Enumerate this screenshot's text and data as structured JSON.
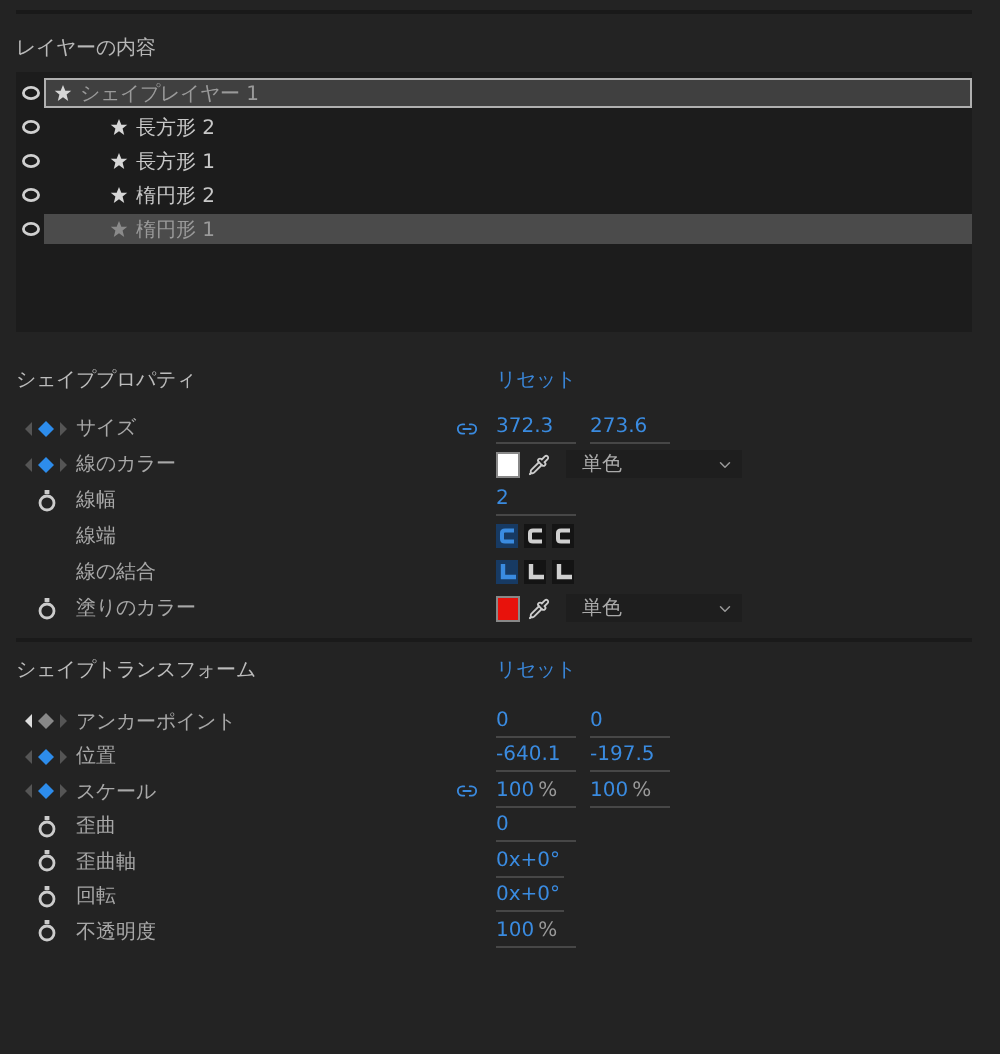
{
  "layer_contents": {
    "title": "レイヤーの内容",
    "layers": [
      {
        "name": "シェイプレイヤー 1",
        "visible": true,
        "selected": true,
        "children": [
          {
            "name": "長方形 2",
            "visible": true,
            "selected": false
          },
          {
            "name": "長方形 1",
            "visible": true,
            "selected": false
          },
          {
            "name": "楕円形 2",
            "visible": true,
            "selected": false
          },
          {
            "name": "楕円形 1",
            "visible": true,
            "selected": true
          }
        ]
      }
    ]
  },
  "sections": [
    {
      "title": "シェイププロパティ",
      "reset": "リセット",
      "properties": [
        {
          "kind": "values",
          "label": "サイズ",
          "keyframed": true,
          "keyframe_active": true,
          "linked": true,
          "values": [
            "372.3",
            "273.6"
          ]
        },
        {
          "kind": "color",
          "label": "線のカラー",
          "keyframed": true,
          "keyframe_active": true,
          "color": "#ffffff",
          "mode": "単色"
        },
        {
          "kind": "values",
          "label": "線幅",
          "keyframed": false,
          "values": [
            "2"
          ]
        },
        {
          "kind": "caps",
          "label": "線端",
          "buttons": [
            {
              "selected": true
            },
            {
              "selected": false
            },
            {
              "selected": false
            }
          ]
        },
        {
          "kind": "joins",
          "label": "線の結合",
          "buttons": [
            {
              "selected": true
            },
            {
              "selected": false
            },
            {
              "selected": false
            }
          ]
        },
        {
          "kind": "color",
          "label": "塗りのカラー",
          "keyframed": false,
          "color": "#e8120c",
          "mode": "単色"
        }
      ]
    },
    {
      "title": "シェイプトランスフォーム",
      "reset": "リセット",
      "properties": [
        {
          "kind": "values",
          "label": "アンカーポイント",
          "keyframed": true,
          "keyframe_active": false,
          "values": [
            "0",
            "0"
          ]
        },
        {
          "kind": "values",
          "label": "位置",
          "keyframed": true,
          "keyframe_active": true,
          "values": [
            "-640.1",
            "-197.5"
          ]
        },
        {
          "kind": "values",
          "label": "スケール",
          "keyframed": true,
          "keyframe_active": true,
          "linked": true,
          "values": [
            "100",
            "100"
          ],
          "unit": "%"
        },
        {
          "kind": "values",
          "label": "歪曲",
          "keyframed": false,
          "values": [
            "0"
          ]
        },
        {
          "kind": "values",
          "label": "歪曲軸",
          "keyframed": false,
          "values": [
            "0x+0°"
          ],
          "short": true
        },
        {
          "kind": "values",
          "label": "回転",
          "keyframed": false,
          "values": [
            "0x+0°"
          ],
          "short": true
        },
        {
          "kind": "values",
          "label": "不透明度",
          "keyframed": false,
          "values": [
            "100"
          ],
          "unit": "%"
        }
      ]
    }
  ]
}
